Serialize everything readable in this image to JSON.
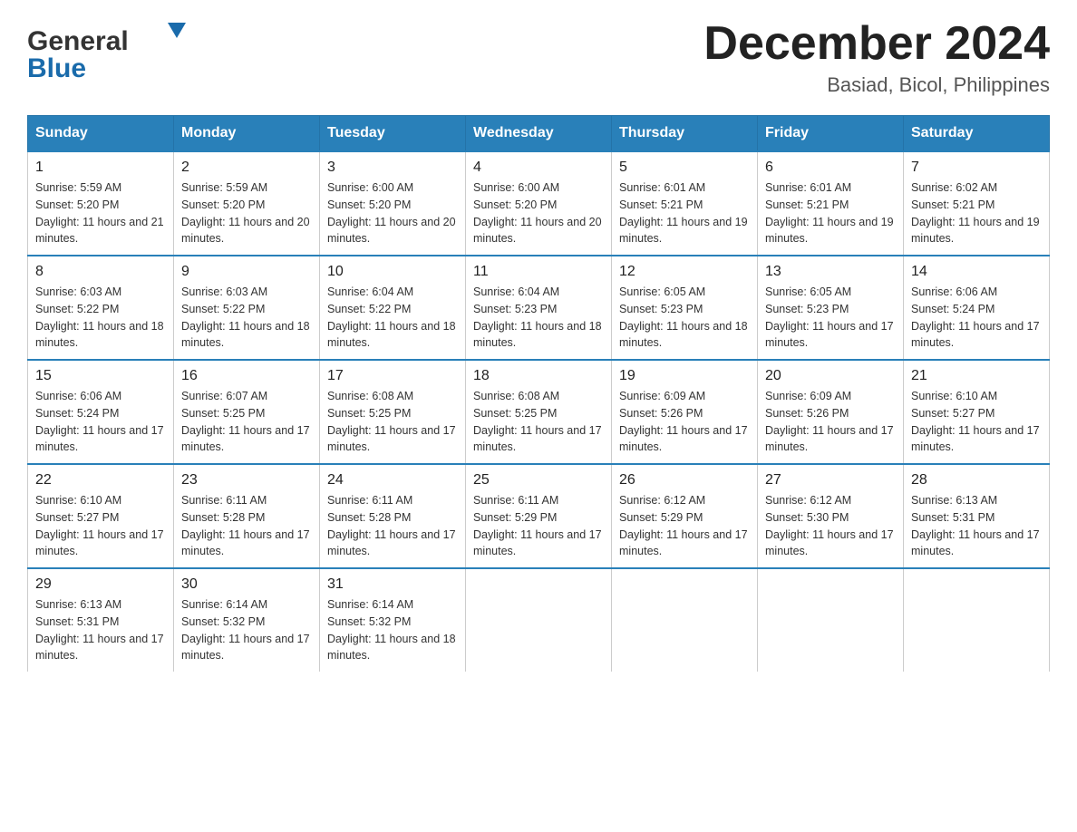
{
  "header": {
    "logo_general": "General",
    "logo_blue": "Blue",
    "month_title": "December 2024",
    "location": "Basiad, Bicol, Philippines"
  },
  "days_of_week": [
    "Sunday",
    "Monday",
    "Tuesday",
    "Wednesday",
    "Thursday",
    "Friday",
    "Saturday"
  ],
  "weeks": [
    [
      {
        "day": "1",
        "sunrise": "Sunrise: 5:59 AM",
        "sunset": "Sunset: 5:20 PM",
        "daylight": "Daylight: 11 hours and 21 minutes."
      },
      {
        "day": "2",
        "sunrise": "Sunrise: 5:59 AM",
        "sunset": "Sunset: 5:20 PM",
        "daylight": "Daylight: 11 hours and 20 minutes."
      },
      {
        "day": "3",
        "sunrise": "Sunrise: 6:00 AM",
        "sunset": "Sunset: 5:20 PM",
        "daylight": "Daylight: 11 hours and 20 minutes."
      },
      {
        "day": "4",
        "sunrise": "Sunrise: 6:00 AM",
        "sunset": "Sunset: 5:20 PM",
        "daylight": "Daylight: 11 hours and 20 minutes."
      },
      {
        "day": "5",
        "sunrise": "Sunrise: 6:01 AM",
        "sunset": "Sunset: 5:21 PM",
        "daylight": "Daylight: 11 hours and 19 minutes."
      },
      {
        "day": "6",
        "sunrise": "Sunrise: 6:01 AM",
        "sunset": "Sunset: 5:21 PM",
        "daylight": "Daylight: 11 hours and 19 minutes."
      },
      {
        "day": "7",
        "sunrise": "Sunrise: 6:02 AM",
        "sunset": "Sunset: 5:21 PM",
        "daylight": "Daylight: 11 hours and 19 minutes."
      }
    ],
    [
      {
        "day": "8",
        "sunrise": "Sunrise: 6:03 AM",
        "sunset": "Sunset: 5:22 PM",
        "daylight": "Daylight: 11 hours and 18 minutes."
      },
      {
        "day": "9",
        "sunrise": "Sunrise: 6:03 AM",
        "sunset": "Sunset: 5:22 PM",
        "daylight": "Daylight: 11 hours and 18 minutes."
      },
      {
        "day": "10",
        "sunrise": "Sunrise: 6:04 AM",
        "sunset": "Sunset: 5:22 PM",
        "daylight": "Daylight: 11 hours and 18 minutes."
      },
      {
        "day": "11",
        "sunrise": "Sunrise: 6:04 AM",
        "sunset": "Sunset: 5:23 PM",
        "daylight": "Daylight: 11 hours and 18 minutes."
      },
      {
        "day": "12",
        "sunrise": "Sunrise: 6:05 AM",
        "sunset": "Sunset: 5:23 PM",
        "daylight": "Daylight: 11 hours and 18 minutes."
      },
      {
        "day": "13",
        "sunrise": "Sunrise: 6:05 AM",
        "sunset": "Sunset: 5:23 PM",
        "daylight": "Daylight: 11 hours and 17 minutes."
      },
      {
        "day": "14",
        "sunrise": "Sunrise: 6:06 AM",
        "sunset": "Sunset: 5:24 PM",
        "daylight": "Daylight: 11 hours and 17 minutes."
      }
    ],
    [
      {
        "day": "15",
        "sunrise": "Sunrise: 6:06 AM",
        "sunset": "Sunset: 5:24 PM",
        "daylight": "Daylight: 11 hours and 17 minutes."
      },
      {
        "day": "16",
        "sunrise": "Sunrise: 6:07 AM",
        "sunset": "Sunset: 5:25 PM",
        "daylight": "Daylight: 11 hours and 17 minutes."
      },
      {
        "day": "17",
        "sunrise": "Sunrise: 6:08 AM",
        "sunset": "Sunset: 5:25 PM",
        "daylight": "Daylight: 11 hours and 17 minutes."
      },
      {
        "day": "18",
        "sunrise": "Sunrise: 6:08 AM",
        "sunset": "Sunset: 5:25 PM",
        "daylight": "Daylight: 11 hours and 17 minutes."
      },
      {
        "day": "19",
        "sunrise": "Sunrise: 6:09 AM",
        "sunset": "Sunset: 5:26 PM",
        "daylight": "Daylight: 11 hours and 17 minutes."
      },
      {
        "day": "20",
        "sunrise": "Sunrise: 6:09 AM",
        "sunset": "Sunset: 5:26 PM",
        "daylight": "Daylight: 11 hours and 17 minutes."
      },
      {
        "day": "21",
        "sunrise": "Sunrise: 6:10 AM",
        "sunset": "Sunset: 5:27 PM",
        "daylight": "Daylight: 11 hours and 17 minutes."
      }
    ],
    [
      {
        "day": "22",
        "sunrise": "Sunrise: 6:10 AM",
        "sunset": "Sunset: 5:27 PM",
        "daylight": "Daylight: 11 hours and 17 minutes."
      },
      {
        "day": "23",
        "sunrise": "Sunrise: 6:11 AM",
        "sunset": "Sunset: 5:28 PM",
        "daylight": "Daylight: 11 hours and 17 minutes."
      },
      {
        "day": "24",
        "sunrise": "Sunrise: 6:11 AM",
        "sunset": "Sunset: 5:28 PM",
        "daylight": "Daylight: 11 hours and 17 minutes."
      },
      {
        "day": "25",
        "sunrise": "Sunrise: 6:11 AM",
        "sunset": "Sunset: 5:29 PM",
        "daylight": "Daylight: 11 hours and 17 minutes."
      },
      {
        "day": "26",
        "sunrise": "Sunrise: 6:12 AM",
        "sunset": "Sunset: 5:29 PM",
        "daylight": "Daylight: 11 hours and 17 minutes."
      },
      {
        "day": "27",
        "sunrise": "Sunrise: 6:12 AM",
        "sunset": "Sunset: 5:30 PM",
        "daylight": "Daylight: 11 hours and 17 minutes."
      },
      {
        "day": "28",
        "sunrise": "Sunrise: 6:13 AM",
        "sunset": "Sunset: 5:31 PM",
        "daylight": "Daylight: 11 hours and 17 minutes."
      }
    ],
    [
      {
        "day": "29",
        "sunrise": "Sunrise: 6:13 AM",
        "sunset": "Sunset: 5:31 PM",
        "daylight": "Daylight: 11 hours and 17 minutes."
      },
      {
        "day": "30",
        "sunrise": "Sunrise: 6:14 AM",
        "sunset": "Sunset: 5:32 PM",
        "daylight": "Daylight: 11 hours and 17 minutes."
      },
      {
        "day": "31",
        "sunrise": "Sunrise: 6:14 AM",
        "sunset": "Sunset: 5:32 PM",
        "daylight": "Daylight: 11 hours and 18 minutes."
      },
      {
        "day": "",
        "sunrise": "",
        "sunset": "",
        "daylight": ""
      },
      {
        "day": "",
        "sunrise": "",
        "sunset": "",
        "daylight": ""
      },
      {
        "day": "",
        "sunrise": "",
        "sunset": "",
        "daylight": ""
      },
      {
        "day": "",
        "sunrise": "",
        "sunset": "",
        "daylight": ""
      }
    ]
  ]
}
